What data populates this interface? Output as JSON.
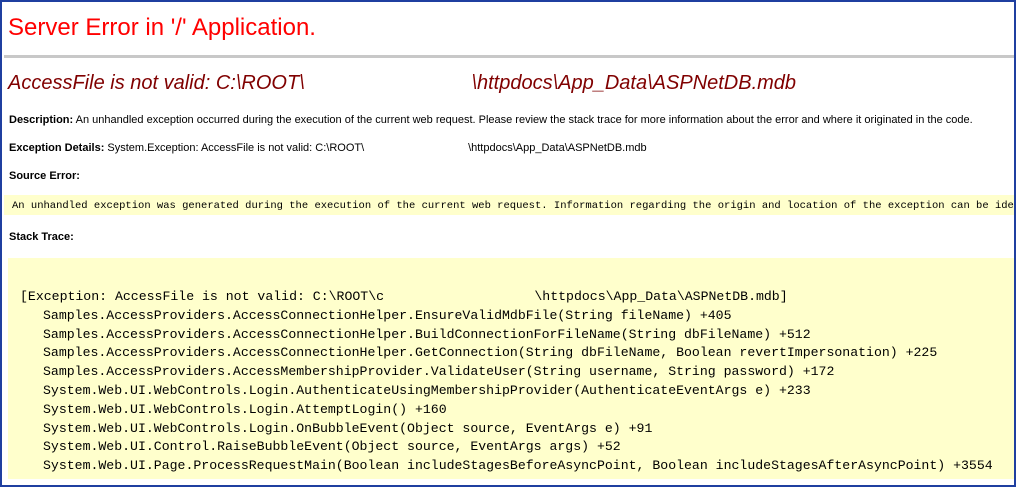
{
  "page": {
    "title": "Server Error in '/' Application.",
    "error_message": "AccessFile is not valid: C:\\ROOT\\                              \\httpdocs\\App_Data\\ASPNetDB.mdb",
    "description": {
      "label": "Description:",
      "text": " An unhandled exception occurred during the execution of the current web request. Please review the stack trace for more information about the error and where it originated in the code."
    },
    "exception_details": {
      "label": "Exception Details:",
      "text": " System.Exception: AccessFile is not valid: C:\\ROOT\\                                  \\httpdocs\\App_Data\\ASPNetDB.mdb"
    },
    "source_error": {
      "label": "Source Error:",
      "text": "An unhandled exception was generated during the execution of the current web request. Information regarding the origin and location of the exception can be identified using the exception stack trace below."
    },
    "stack_trace": {
      "label": "Stack Trace:",
      "exception_line": "[Exception: AccessFile is not valid: C:\\ROOT\\c                   \\httpdocs\\App_Data\\ASPNetDB.mdb]",
      "frames": [
        "Samples.AccessProviders.AccessConnectionHelper.EnsureValidMdbFile(String fileName) +405",
        "Samples.AccessProviders.AccessConnectionHelper.BuildConnectionForFileName(String dbFileName) +512",
        "Samples.AccessProviders.AccessConnectionHelper.GetConnection(String dbFileName, Boolean revertImpersonation) +225",
        "Samples.AccessProviders.AccessMembershipProvider.ValidateUser(String username, String password) +172",
        "System.Web.UI.WebControls.Login.AuthenticateUsingMembershipProvider(AuthenticateEventArgs e) +233",
        "System.Web.UI.WebControls.Login.AttemptLogin() +160",
        "System.Web.UI.WebControls.Login.OnBubbleEvent(Object source, EventArgs e) +91",
        "System.Web.UI.Control.RaiseBubbleEvent(Object source, EventArgs args) +52",
        "System.Web.UI.Page.ProcessRequestMain(Boolean includeStagesBeforeAsyncPoint, Boolean includeStagesAfterAsyncPoint) +3554"
      ]
    }
  },
  "colors": {
    "title": "#ff0000",
    "error_message": "#800000",
    "code_background": "#ffffcc",
    "frame_border": "#1f3fa0"
  }
}
